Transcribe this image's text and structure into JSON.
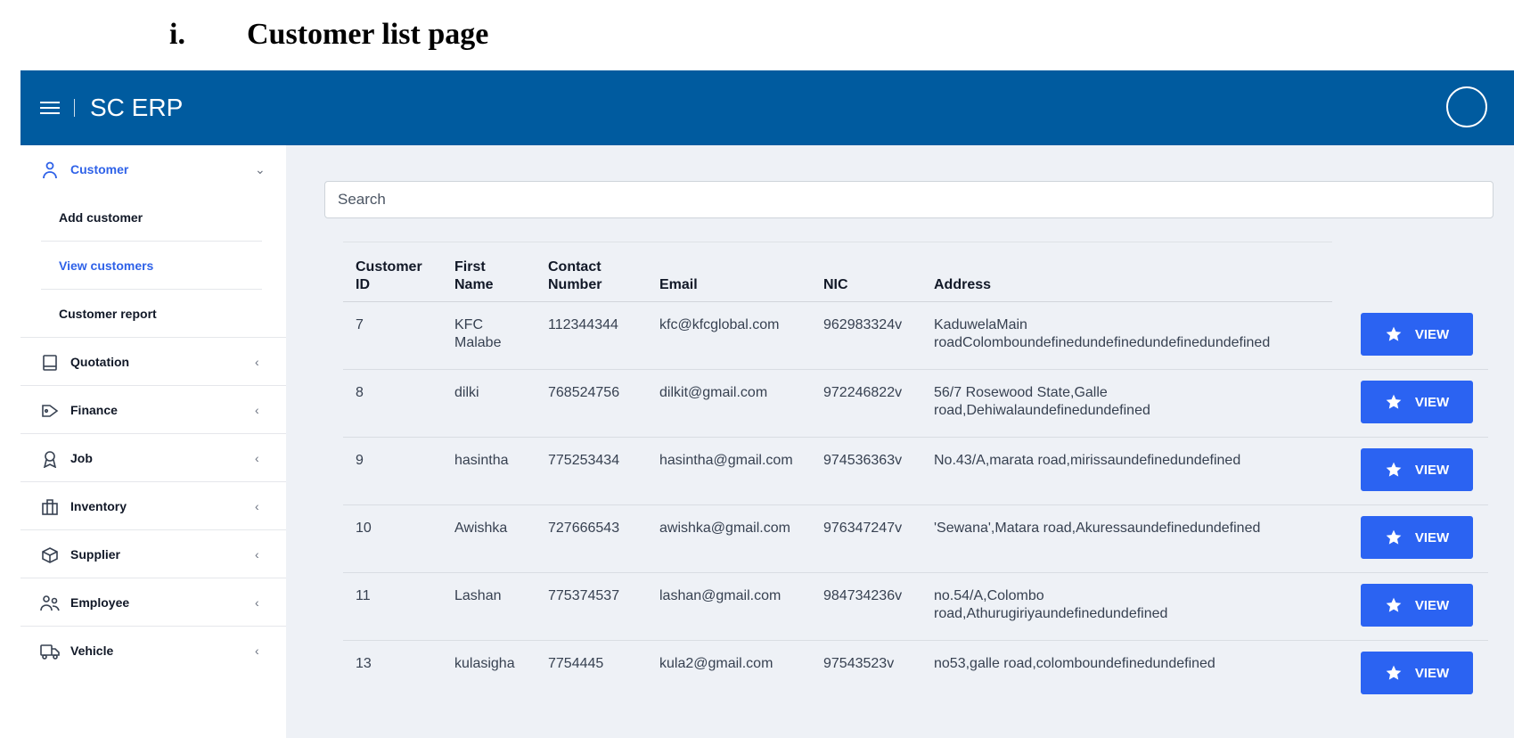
{
  "heading": {
    "number": "i.",
    "title": "Customer list page"
  },
  "app": {
    "brand": "SC ERP"
  },
  "sidebar": {
    "items": [
      {
        "label": "Customer",
        "icon": "user-icon"
      },
      {
        "label": "Quotation",
        "icon": "book-icon"
      },
      {
        "label": "Finance",
        "icon": "tag-icon"
      },
      {
        "label": "Job",
        "icon": "badge-icon"
      },
      {
        "label": "Inventory",
        "icon": "building-icon"
      },
      {
        "label": "Supplier",
        "icon": "box-icon"
      },
      {
        "label": "Employee",
        "icon": "users-icon"
      },
      {
        "label": "Vehicle",
        "icon": "truck-icon"
      }
    ],
    "sub_items": [
      {
        "label": "Add customer"
      },
      {
        "label": "View customers"
      },
      {
        "label": "Customer report"
      }
    ],
    "active_color": "#2f62e8"
  },
  "search": {
    "placeholder": "Search"
  },
  "table": {
    "headers": [
      "Customer\nID",
      "First\nName",
      "Contact\nNumber",
      "Email",
      "NIC",
      "Address"
    ],
    "rows": [
      {
        "id": "7",
        "first_name": "KFC\nMalabe",
        "contact": "112344344",
        "email": "kfc@kfcglobal.com",
        "nic": "962983324v",
        "address": "KaduwelaMain\nroadColomboundefinedundefinedundefinedundefined"
      },
      {
        "id": "8",
        "first_name": "dilki",
        "contact": "768524756",
        "email": "dilkit@gmail.com",
        "nic": "972246822v",
        "address": "56/7 Rosewood State,Galle\nroad,Dehiwalaundefinedundefined"
      },
      {
        "id": "9",
        "first_name": "hasintha",
        "contact": "775253434",
        "email": "hasintha@gmail.com",
        "nic": "974536363v",
        "address": "No.43/A,marata road,mirissaundefinedundefined"
      },
      {
        "id": "10",
        "first_name": "Awishka",
        "contact": "727666543",
        "email": "awishka@gmail.com",
        "nic": "976347247v",
        "address": "'Sewana',Matara road,Akuressaundefinedundefined"
      },
      {
        "id": "11",
        "first_name": "Lashan",
        "contact": "775374537",
        "email": "lashan@gmail.com",
        "nic": "984734236v",
        "address": "no.54/A,Colombo\nroad,Athurugiriyaundefinedundefined"
      },
      {
        "id": "13",
        "first_name": "kulasigha",
        "contact": "7754445",
        "email": "kula2@gmail.com",
        "nic": "97543523v",
        "address": "no53,galle road,colomboundefinedundefined"
      }
    ],
    "action_label": "VIEW",
    "action_icon": "star-icon"
  },
  "colors": {
    "topbar": "#005b9f",
    "button": "#2b63f2",
    "background": "#eef1f6"
  }
}
